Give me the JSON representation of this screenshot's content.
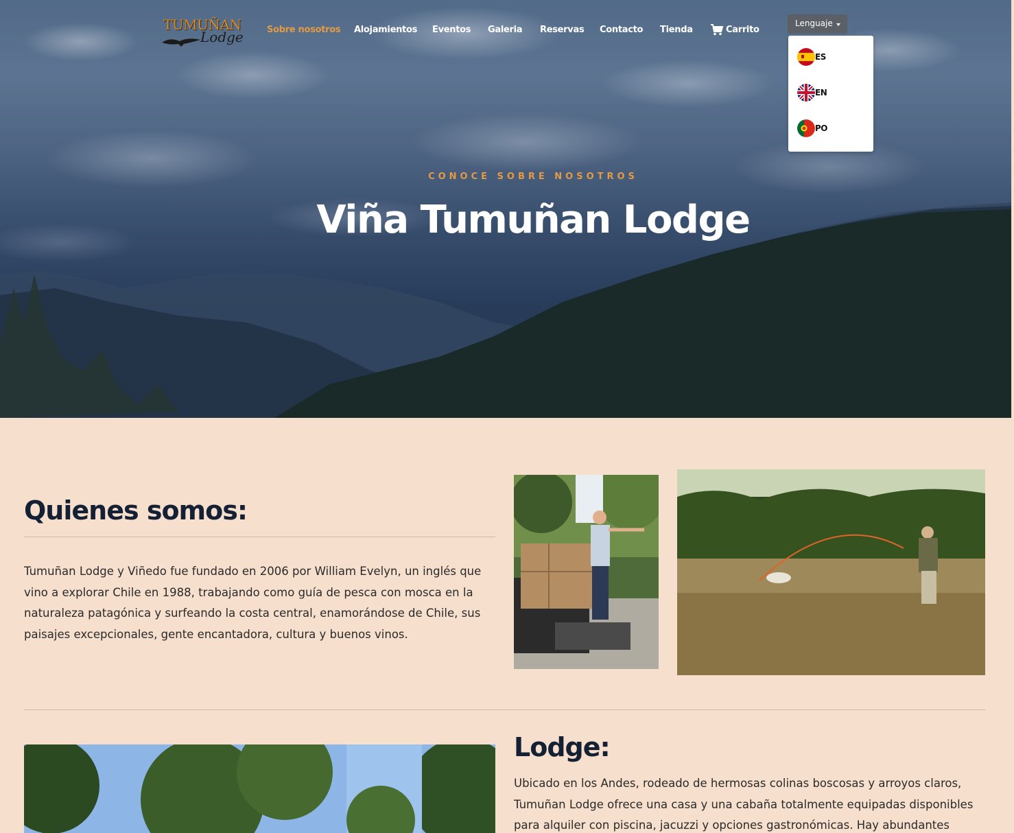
{
  "brand": {
    "logo_line1": "TUMUÑAN",
    "logo_line2": "Lodge"
  },
  "nav": {
    "items": [
      {
        "label": "Sobre nosotros",
        "active": true
      },
      {
        "label": "Alojamientos",
        "active": false
      },
      {
        "label": "Eventos",
        "active": false
      },
      {
        "label": "Galeria",
        "active": false
      },
      {
        "label": "Reservas",
        "active": false
      },
      {
        "label": "Contacto",
        "active": false
      },
      {
        "label": "Tienda",
        "active": false
      }
    ],
    "cart_label": "Carrito",
    "cart_icon": "shopping-cart-icon",
    "accent_color": "#e39a45"
  },
  "language": {
    "button_label": "Lenguaje",
    "options": [
      {
        "code": "ES",
        "flag": "spain-flag-icon"
      },
      {
        "code": "EN",
        "flag": "uk-flag-icon"
      },
      {
        "code": "PO",
        "flag": "portugal-flag-icon"
      }
    ]
  },
  "hero": {
    "subtitle": "CONOCE SOBRE NOSOTROS",
    "title": "Viña Tumuñan Lodge"
  },
  "about": {
    "heading": "Quienes somos:",
    "text": "Tumuñan Lodge y Viñedo fue fundado en 2006 por William Evelyn, un inglés que vino a explorar Chile en 1988, trabajando como guía de pesca con mosca en la naturaleza patagónica y surfeando la costa central, enamorándose de Chile, sus paisajes excepcionales, gente encantadora, cultura y buenos vinos."
  },
  "lodge": {
    "heading": "Lodge:",
    "text": "Ubicado en los Andes, rodeado de hermosas colinas boscosas y arroyos claros, Tumuñan Lodge ofrece una casa y una cabaña totalmente equipadas disponibles para alquiler con piscina, jacuzzi y opciones gastronómicas. Hay abundantes"
  },
  "colors": {
    "page_background": "#f6dfcc",
    "heading": "#142033",
    "accent": "#e39a45"
  }
}
